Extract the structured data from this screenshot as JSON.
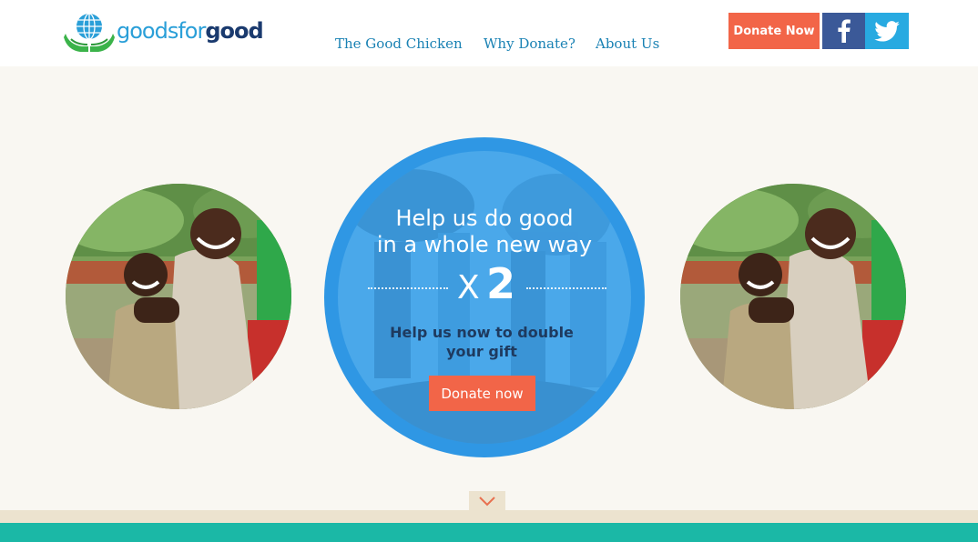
{
  "logo": {
    "part1": "goodsfor",
    "part2": "good"
  },
  "nav": {
    "items": [
      {
        "label": "The Good Chicken"
      },
      {
        "label": "Why Donate?"
      },
      {
        "label": "About Us"
      }
    ]
  },
  "header": {
    "donate_label": "Donate Now",
    "facebook_icon": "facebook-icon",
    "twitter_icon": "twitter-icon"
  },
  "hero": {
    "title_line1": "Help us do good",
    "title_line2": "in a whole new way",
    "multiplier_x": "X",
    "multiplier_n": "2",
    "subtitle_line1": "Help us now to double",
    "subtitle_line2": "your gift",
    "donate_label": "Donate now"
  },
  "colors": {
    "accent_orange": "#f26548",
    "hero_blue": "#2f97e4",
    "nav_blue": "#1a82b4",
    "facebook": "#3b5998",
    "twitter": "#28aae1",
    "teal": "#1bb8a6",
    "background": "#f9f7f2"
  },
  "icons": {
    "scroll": "chevron-down-icon",
    "logo": "globe-hands-icon"
  }
}
